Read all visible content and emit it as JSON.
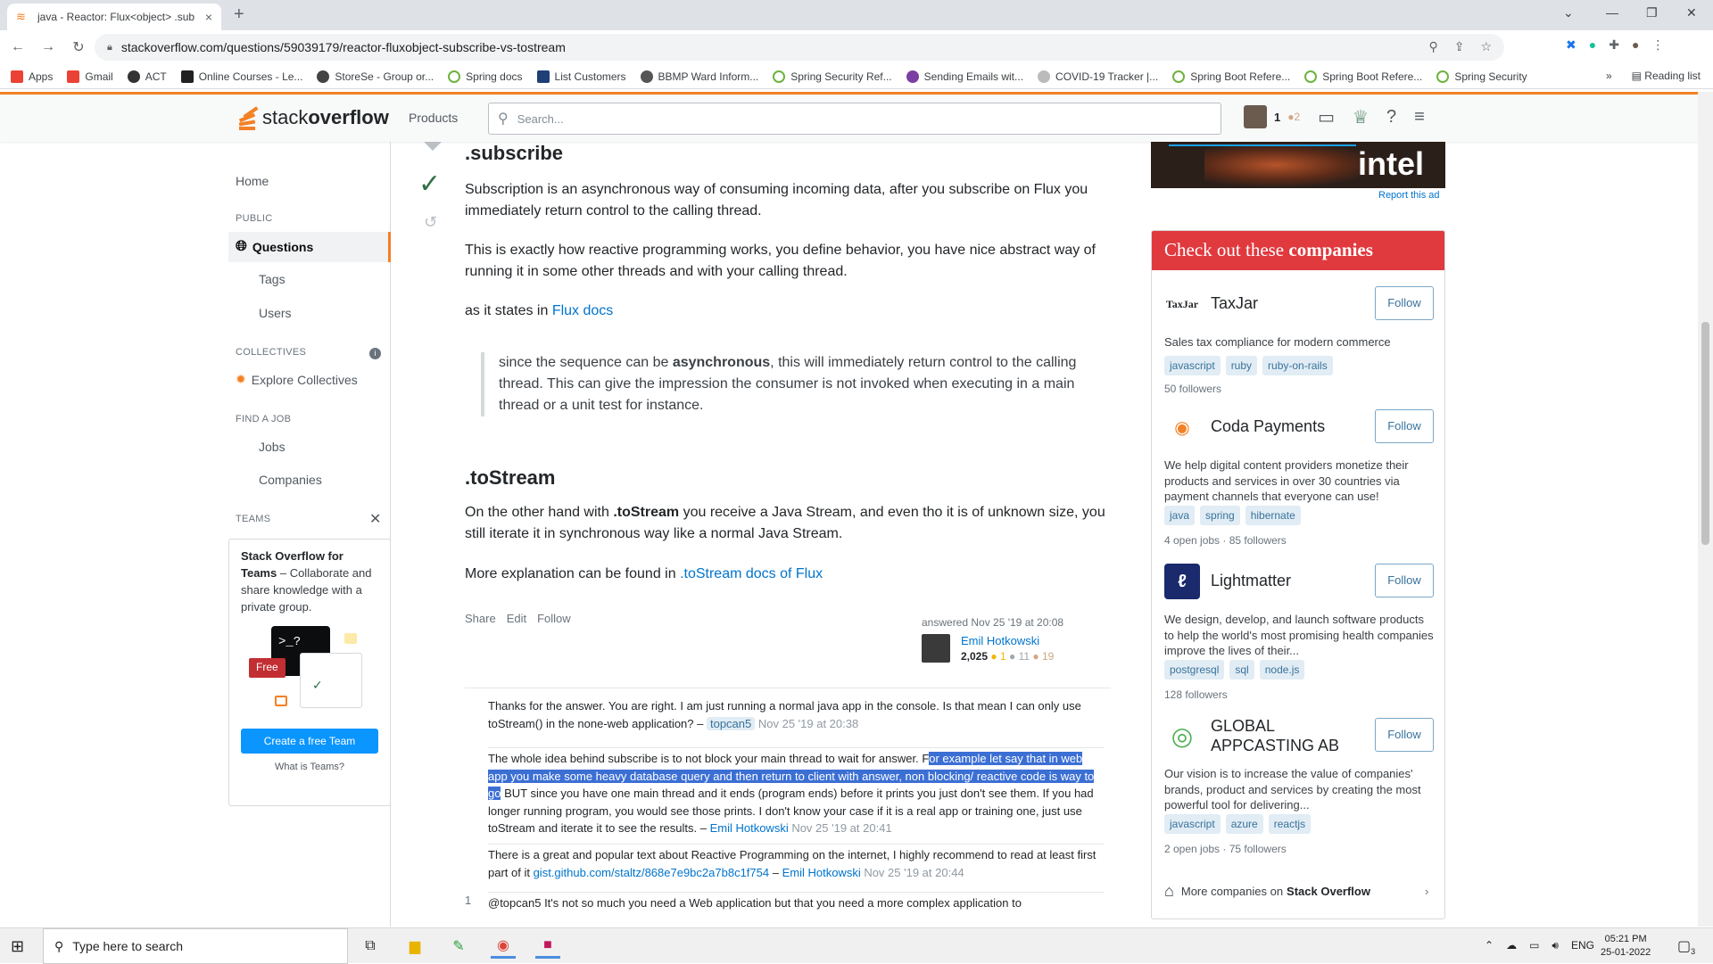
{
  "browser": {
    "tab_title": "java - Reactor: Flux<object> .sub",
    "tab_close": "×",
    "new_tab": "+",
    "url": "stackoverflow.com/questions/59039179/reactor-fluxobject-subscribe-vs-tostream",
    "bookmarks": [
      "Apps",
      "Gmail",
      "ACT",
      "Online Courses - Le...",
      "StoreSe - Group or...",
      "Spring docs",
      "List Customers",
      "BBMP Ward Inform...",
      "Spring Security Ref...",
      "Sending Emails wit...",
      "COVID-19 Tracker |...",
      "Spring Boot Refere...",
      "Spring Boot Refere...",
      "Spring Security"
    ],
    "bookmarks_more": "»",
    "reading_list": "Reading list"
  },
  "so_header": {
    "logo_light": "stack",
    "logo_bold": "overflow",
    "products": "Products",
    "search_placeholder": "Search...",
    "rep": "1",
    "bronze": "●2"
  },
  "leftnav": {
    "home": "Home",
    "public": "PUBLIC",
    "questions": "Questions",
    "tags": "Tags",
    "users": "Users",
    "collectives": "COLLECTIVES",
    "explore": "Explore Collectives",
    "find_job": "FIND A JOB",
    "jobs": "Jobs",
    "companies": "Companies",
    "teams": "TEAMS",
    "teams_title": "Stack Overflow for Teams",
    "teams_desc": " – Collaborate and share knowledge with a private group.",
    "free": "Free",
    "create_team": "Create a free Team",
    "what_teams": "What is Teams?"
  },
  "answer": {
    "h_subscribe": ".subscribe",
    "p1": "Subscription is an asynchronous way of consuming incoming data, after you subscribe on Flux you immediately return control to the calling thread.",
    "p2": "This is exactly how reactive programming works, you define behavior, you have nice abstract way of running it in some other threads and with your calling thread.",
    "p3_prefix": "as it states in ",
    "p3_link": "Flux docs",
    "quote_a": "since the sequence can be ",
    "quote_bold": "asynchronous",
    "quote_b": ", this will immediately return control to the calling thread. This can give the impression the consumer is not invoked when executing in a main thread or a unit test for instance.",
    "h_tostream": ".toStream",
    "p4_a": "On the other hand with ",
    "p4_bold": ".toStream",
    "p4_b": " you receive a Java Stream, and even tho it is of unknown size, you still iterate it in synchronous way like a normal Java Stream.",
    "p5_prefix": "More explanation can be found in ",
    "p5_link": ".toStream docs of Flux",
    "share": "Share",
    "edit": "Edit",
    "follow": "Follow",
    "answered": "answered Nov 25 '19 at 20:08",
    "author": "Emil Hotkowski",
    "author_rep": "2,025",
    "gold": "● 1",
    "silver": "● 11",
    "bronze": "● 19"
  },
  "comments": [
    {
      "text": "Thanks for the answer. You are right. I am just running a normal java app in the console. Is that mean I can only use toStream() in the none-web application? – ",
      "user": "topcan5",
      "date": " Nov 25 '19 at 20:38"
    },
    {
      "text_a": "The whole idea behind subscribe is to not block your main thread to wait for answer. F",
      "text_sel": "or example let say that in web app you make some heavy database query and then return to client with answer, non blocking/ reactive code is way to go",
      "text_b": " BUT since you have one main thread and it ends (program ends) before it prints you just don't see them. If you had longer running program, you would see those prints. I don't know your case if it is a real app or training one, just use toStream and iterate it to see the results. – ",
      "user": "Emil Hotkowski",
      "date": " Nov 25 '19 at 20:41"
    },
    {
      "text_a": "There is a great and popular text about Reactive Programming on the internet, I highly recommend to read at least first part of it ",
      "link": "gist.github.com/staltz/868e7e9bc2a7b8c1f754",
      "dash": " – ",
      "user": "Emil Hotkowski",
      "date": " Nov 25 '19 at 20:44"
    },
    {
      "score": "1",
      "text": "@topcan5 It's not so much you need a Web application but that you need a more complex application to"
    }
  ],
  "ad": {
    "brand": "intel",
    "report": "Report this ad"
  },
  "companies": {
    "title_a": "Check out these ",
    "title_b": "companies",
    "items": [
      {
        "name": "TaxJar",
        "logo": "TaxJar",
        "follow": "Follow",
        "desc": "Sales tax compliance for modern commerce",
        "tags": [
          "javascript",
          "ruby",
          "ruby-on-rails"
        ],
        "foot": "50 followers"
      },
      {
        "name": "Coda Payments",
        "follow": "Follow",
        "desc": "We help digital content providers monetize their products and services in over 30 countries via payment channels that everyone can use!",
        "tags": [
          "java",
          "spring",
          "hibernate"
        ],
        "foot": "4 open jobs · 85 followers"
      },
      {
        "name": "Lightmatter",
        "follow": "Follow",
        "desc": "We design, develop, and launch software products to help the world's most promising health companies improve the lives of their...",
        "tags": [
          "postgresql",
          "sql",
          "node.js"
        ],
        "foot": "128 followers"
      },
      {
        "name": "GLOBAL APPCASTING AB",
        "follow": "Follow",
        "desc": "Our vision is to increase the value of companies' brands, product and services by creating the most powerful tool for delivering...",
        "tags": [
          "javascript",
          "azure",
          "reactjs"
        ],
        "foot": "2 open jobs · 75 followers"
      }
    ],
    "more_a": "More companies on",
    "more_b": "Stack Overflow"
  },
  "taskbar": {
    "search": "Type here to search",
    "lang": "ENG",
    "time": "05:21 PM",
    "date": "25-01-2022",
    "notif_count": "3"
  }
}
